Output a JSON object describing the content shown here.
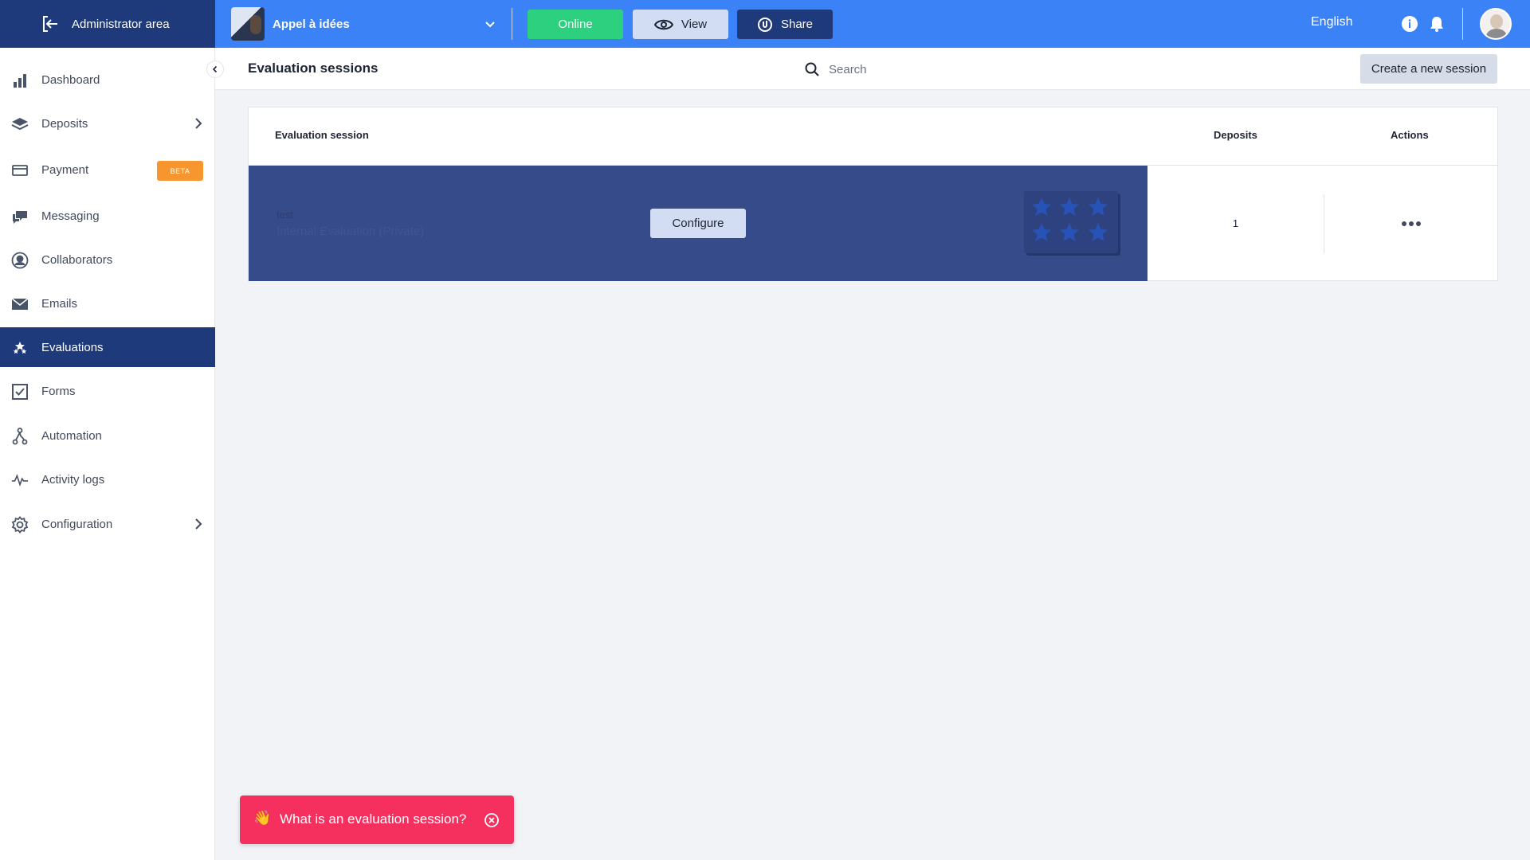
{
  "topbar": {
    "admin_label": "Administrator area",
    "project_name": "Appel à idées",
    "online_label": "Online",
    "view_label": "View",
    "share_label": "Share",
    "language": "English",
    "colors": {
      "bar": "#3b82f6",
      "dark": "#1e3a7a",
      "online": "#2dd07e"
    }
  },
  "sidebar": {
    "items": [
      {
        "label": "Dashboard",
        "icon": "bar-chart-icon"
      },
      {
        "label": "Deposits",
        "icon": "layers-icon",
        "has_children": true
      },
      {
        "label": "Payment",
        "icon": "credit-card-icon",
        "badge": "BETA"
      },
      {
        "label": "Messaging",
        "icon": "chat-icon"
      },
      {
        "label": "Collaborators",
        "icon": "user-circle-icon"
      },
      {
        "label": "Emails",
        "icon": "envelope-icon"
      },
      {
        "label": "Evaluations",
        "icon": "stars-icon",
        "active": true
      },
      {
        "label": "Forms",
        "icon": "checkbox-icon"
      },
      {
        "label": "Automation",
        "icon": "automation-icon"
      },
      {
        "label": "Activity logs",
        "icon": "pulse-icon"
      },
      {
        "label": "Configuration",
        "icon": "gear-icon",
        "has_children": true
      }
    ]
  },
  "header": {
    "title": "Evaluation sessions",
    "search_placeholder": "Search",
    "create_label": "Create a new session"
  },
  "table": {
    "columns": [
      "Evaluation session",
      "Deposits",
      "Actions"
    ],
    "rows": [
      {
        "name": "test",
        "type": "Internal Evaluation (Private)",
        "configure_label": "Configure",
        "deposits": "1"
      }
    ]
  },
  "help": {
    "emoji": "👋",
    "text": "What is an evaluation session?"
  }
}
